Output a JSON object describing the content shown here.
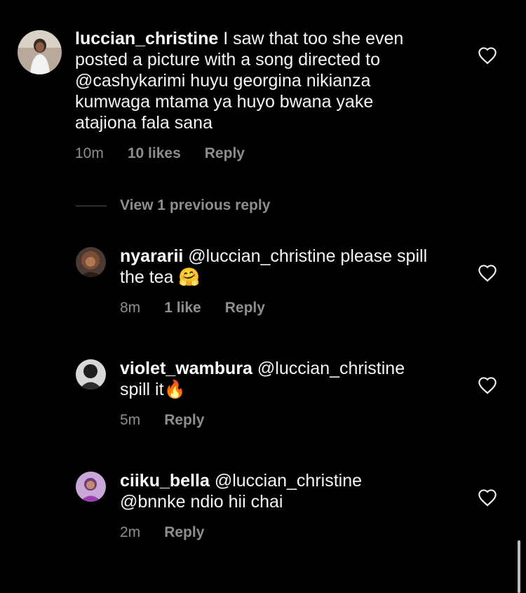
{
  "comments": [
    {
      "username": "luccian_christine",
      "text": "I saw that too she even",
      "text_lines": [
        "posted a picture with a song directed to",
        "@cashykarimi  huyu georgina nikianza",
        "kumwaga mtama ya huyo bwana yake",
        "atajiona fala sana"
      ],
      "time": "10m",
      "likes": "10 likes",
      "reply": "Reply"
    }
  ],
  "view_previous": "View 1 previous reply",
  "replies": [
    {
      "username": "nyararii",
      "line1": "@luccian_christine please spill",
      "line2": "the tea 🤗",
      "time": "8m",
      "likes": "1 like",
      "reply": "Reply"
    },
    {
      "username": "violet_wambura",
      "line1": "@luccian_christine",
      "line2": "spill it🔥",
      "time": "5m",
      "reply": "Reply"
    },
    {
      "username": "ciiku_bella",
      "line1": "@luccian_christine",
      "line2": "@bnnke ndio hii chai",
      "time": "2m",
      "reply": "Reply"
    }
  ],
  "icons": {
    "like": "heart-outline-icon"
  },
  "colors": {
    "background": "#000000",
    "text": "#f5f5f5",
    "secondary": "#8e8e8e"
  }
}
